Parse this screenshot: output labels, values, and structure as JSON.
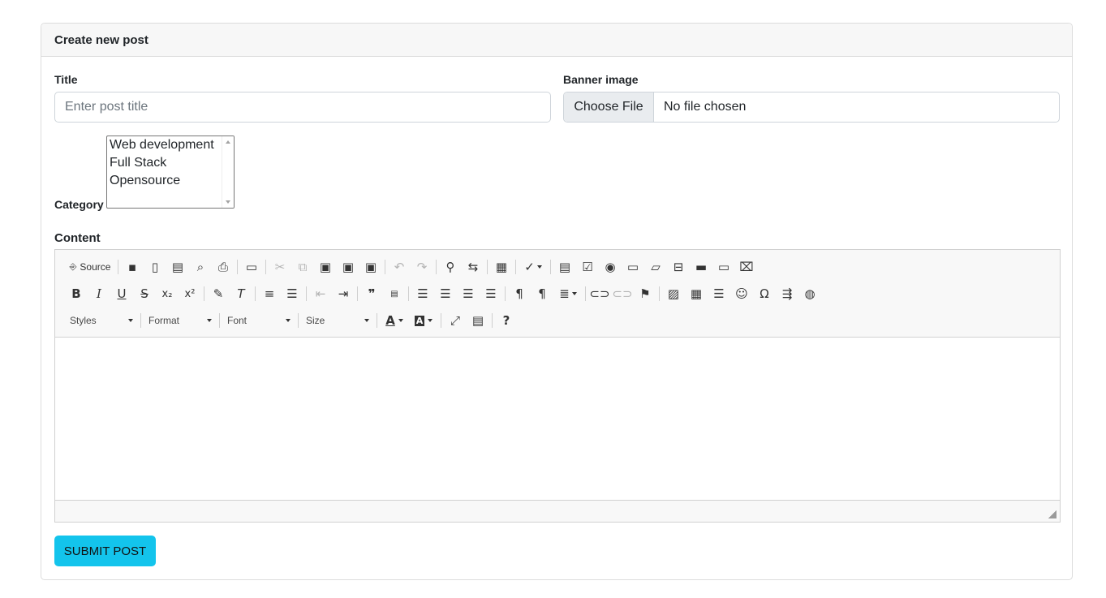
{
  "card": {
    "header": "Create new post"
  },
  "title": {
    "label": "Title",
    "placeholder": "Enter post title",
    "value": ""
  },
  "banner": {
    "label": "Banner image",
    "button": "Choose File",
    "status": "No file chosen"
  },
  "category": {
    "label": "Category",
    "options": [
      "Web development",
      "Full Stack",
      "Opensource"
    ]
  },
  "content": {
    "label": "Content",
    "toolbar": {
      "source_label": "Source",
      "styles": "Styles",
      "format": "Format",
      "font": "Font",
      "size": "Size"
    }
  },
  "submit": {
    "label": "SUBMIT POST"
  },
  "colors": {
    "accent": "#13c4ec",
    "header_bg": "#f7f7f7",
    "border": "#dcdcdc"
  }
}
